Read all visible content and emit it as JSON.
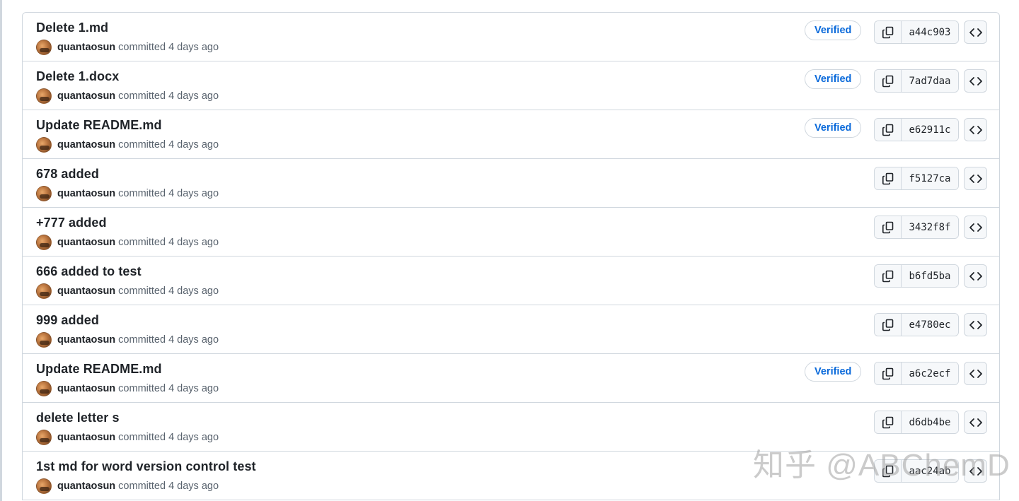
{
  "commits": [
    {
      "title": "Delete 1.md",
      "author": "quantaosun",
      "committed_text": "committed 4 days ago",
      "verified": true,
      "sha": "a44c903"
    },
    {
      "title": "Delete 1.docx",
      "author": "quantaosun",
      "committed_text": "committed 4 days ago",
      "verified": true,
      "sha": "7ad7daa"
    },
    {
      "title": "Update README.md",
      "author": "quantaosun",
      "committed_text": "committed 4 days ago",
      "verified": true,
      "sha": "e62911c"
    },
    {
      "title": "678 added",
      "author": "quantaosun",
      "committed_text": "committed 4 days ago",
      "verified": false,
      "sha": "f5127ca"
    },
    {
      "title": "+777 added",
      "author": "quantaosun",
      "committed_text": "committed 4 days ago",
      "verified": false,
      "sha": "3432f8f"
    },
    {
      "title": "666 added to test",
      "author": "quantaosun",
      "committed_text": "committed 4 days ago",
      "verified": false,
      "sha": "b6fd5ba"
    },
    {
      "title": "999 added",
      "author": "quantaosun",
      "committed_text": "committed 4 days ago",
      "verified": false,
      "sha": "e4780ec"
    },
    {
      "title": "Update README.md",
      "author": "quantaosun",
      "committed_text": "committed 4 days ago",
      "verified": true,
      "sha": "a6c2ecf"
    },
    {
      "title": "delete letter s",
      "author": "quantaosun",
      "committed_text": "committed 4 days ago",
      "verified": false,
      "sha": "d6db4be"
    },
    {
      "title": "1st md for word version control test",
      "author": "quantaosun",
      "committed_text": "committed 4 days ago",
      "verified": false,
      "sha": "aac24ab"
    }
  ],
  "verified_label": "Verified",
  "icons": {
    "copy": "copy-icon",
    "browse": "code-icon",
    "avatar": "avatar"
  },
  "colors": {
    "verified_text": "#0969da",
    "border": "#d0d7de",
    "button_bg": "#f6f8fa",
    "muted_text": "#59636e"
  },
  "watermark": "知乎 @ABChemD"
}
